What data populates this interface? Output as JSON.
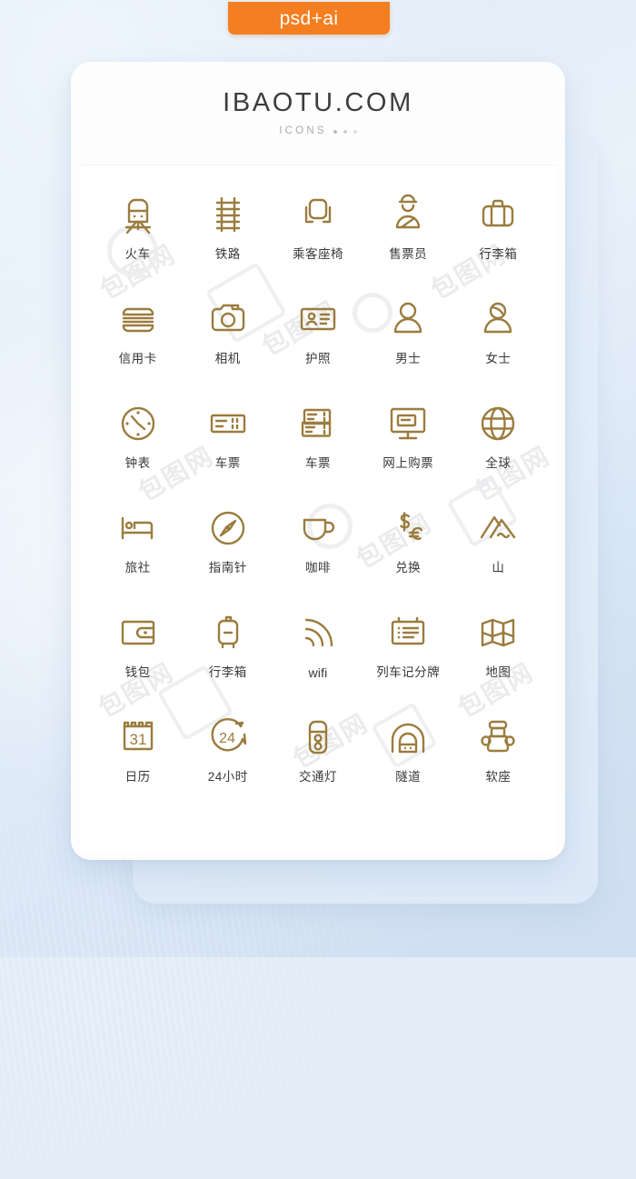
{
  "badge": {
    "label": "psd+ai",
    "color": "#f47e20"
  },
  "header": {
    "title": "IBAOTU.COM",
    "subtitle": "ICONS",
    "dots": 3
  },
  "theme": {
    "icon_color": "#9b7c3e",
    "label_color": "#383838",
    "card_bg": "#fdfdfe",
    "page_bg": "#e3edf8"
  },
  "grid": {
    "columns": 5,
    "rows": 6,
    "icons": [
      {
        "label": "火车",
        "name": "train-icon"
      },
      {
        "label": "铁路",
        "name": "railway-icon"
      },
      {
        "label": "乘客座椅",
        "name": "passenger-seat-icon"
      },
      {
        "label": "售票员",
        "name": "ticket-clerk-icon"
      },
      {
        "label": "行李箱",
        "name": "suitcase-icon"
      },
      {
        "label": "信用卡",
        "name": "credit-card-icon"
      },
      {
        "label": "相机",
        "name": "camera-icon"
      },
      {
        "label": "护照",
        "name": "passport-icon"
      },
      {
        "label": "男士",
        "name": "man-icon"
      },
      {
        "label": "女士",
        "name": "woman-icon"
      },
      {
        "label": "钟表",
        "name": "clock-icon"
      },
      {
        "label": "车票",
        "name": "ticket-icon"
      },
      {
        "label": "车票",
        "name": "tickets-icon"
      },
      {
        "label": "网上购票",
        "name": "online-booking-icon"
      },
      {
        "label": "全球",
        "name": "globe-icon"
      },
      {
        "label": "旅社",
        "name": "hotel-bed-icon"
      },
      {
        "label": "指南针",
        "name": "compass-icon"
      },
      {
        "label": "咖啡",
        "name": "coffee-cup-icon"
      },
      {
        "label": "兑换",
        "name": "currency-exchange-icon"
      },
      {
        "label": "山",
        "name": "mountain-icon"
      },
      {
        "label": "钱包",
        "name": "wallet-icon"
      },
      {
        "label": "行李箱",
        "name": "rolling-luggage-icon"
      },
      {
        "label": "wifi",
        "name": "wifi-icon"
      },
      {
        "label": "列车记分牌",
        "name": "train-scoreboard-icon"
      },
      {
        "label": "地图",
        "name": "map-icon"
      },
      {
        "label": "日历",
        "name": "calendar-icon"
      },
      {
        "label": "24小时",
        "name": "24-hours-icon"
      },
      {
        "label": "交通灯",
        "name": "traffic-light-icon"
      },
      {
        "label": "隧道",
        "name": "tunnel-icon"
      },
      {
        "label": "软座",
        "name": "soft-seat-icon"
      }
    ]
  },
  "watermark": {
    "text": "包图网"
  }
}
